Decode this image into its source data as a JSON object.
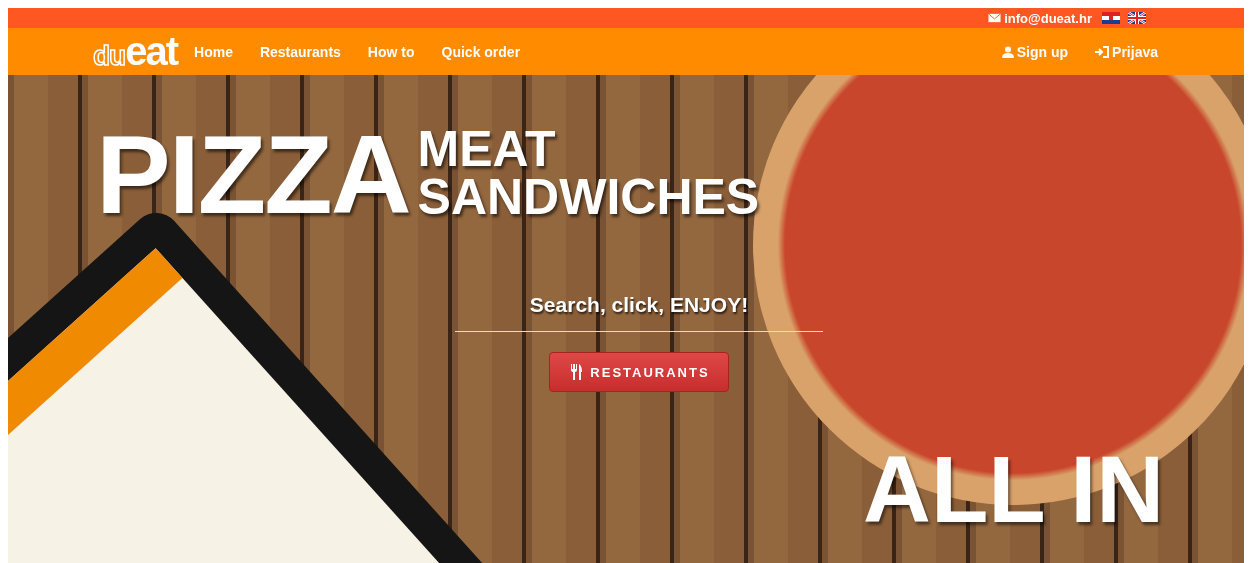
{
  "top_bar": {
    "email": "info@dueat.hr"
  },
  "nav": {
    "logo": {
      "part_1": "du",
      "part_2": "eat"
    },
    "links": [
      "Home",
      "Restaurants",
      "How to",
      "Quick order"
    ],
    "account": [
      {
        "label": "Sign up",
        "kind": "user"
      },
      {
        "label": "Prijava",
        "kind": "login"
      }
    ]
  },
  "hero": {
    "headline": "PIZZA",
    "subheadline": [
      "MEAT",
      "SANDWICHES"
    ],
    "tagline": "Search, click, ENJOY!",
    "button": "RESTAURANTS",
    "slogan": "ALL IN"
  }
}
